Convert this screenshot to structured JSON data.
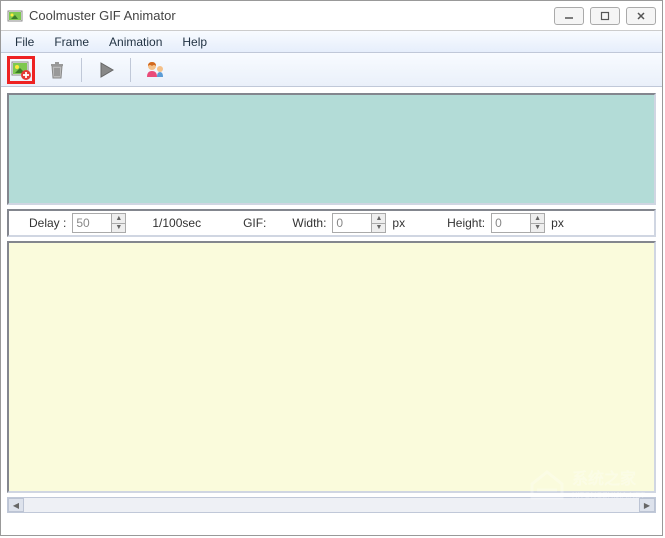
{
  "title": "Coolmuster GIF Animator",
  "menu": {
    "file": "File",
    "frame": "Frame",
    "animation": "Animation",
    "help": "Help"
  },
  "toolbar": {
    "add_image": "add-image",
    "delete": "delete",
    "play": "play",
    "about": "about"
  },
  "controls": {
    "delay_label": "Delay :",
    "delay_value": "50",
    "delay_unit": "1/100sec",
    "gif_label": "GIF:",
    "width_label": "Width:",
    "width_value": "0",
    "width_unit": "px",
    "height_label": "Height:",
    "height_value": "0",
    "height_unit": "px"
  },
  "watermark": "系统之家"
}
